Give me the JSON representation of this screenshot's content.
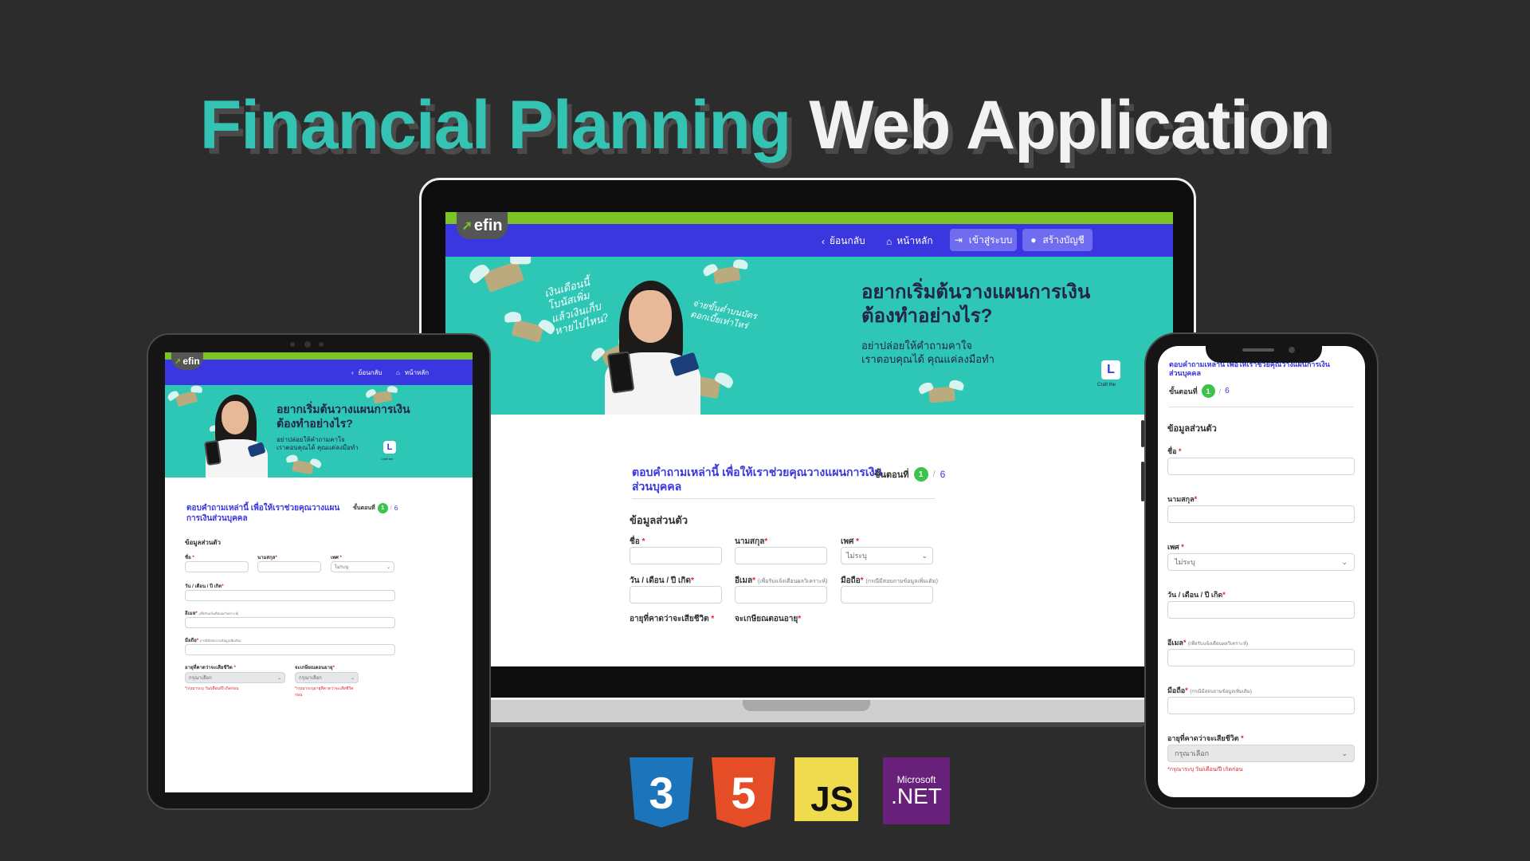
{
  "title": {
    "accent": "Financial Planning",
    "main": "Web Application"
  },
  "site": {
    "logo": "efin",
    "nav": {
      "back": "ย้อนกลับ",
      "home": "หน้าหลัก",
      "login": "เข้าสู่ระบบ",
      "register": "สร้างบัญชี"
    },
    "hero": {
      "headline_1": "อยากเริ่มต้นวางแผนการเงิน",
      "headline_2": "ต้องทำอย่างไร?",
      "sub_1": "อย่าปล่อยให้คำถามคาใจ",
      "sub_2": "เราตอบคุณได้ คุณแค่ลงมือทำ",
      "scribble_left": "เงินเดือนนี้\nโบนัสเพิ่ม\nแล้วเงินเก็บ\nหายไปไหน?",
      "scribble_right": "จ่ายขั้นต่ำบนบัตร\nดอกเบี้ยเท่าไหร่",
      "badge_logo": "L",
      "badge_caption": "Craft the"
    },
    "form": {
      "heading_1": "ตอบคำถามเหล่านี้ เพื่อให้เราช่วยคุณวางแผนการเงิน",
      "heading_2": "ส่วนบุคคล",
      "heading_tablet_1": "ตอบคำถามเหล่านี้ เพื่อให้เราช่วยคุณวางแผน",
      "heading_tablet_2": "การเงินส่วนบุคคล",
      "step_label": "ขั้นตอนที่",
      "step_current": "1",
      "step_sep": "/",
      "step_total": "6",
      "section": "ข้อมูลส่วนตัว",
      "first_name": "ชื่อ",
      "last_name": "นามสกุล",
      "gender": "เพศ",
      "gender_value": "ไม่ระบุ",
      "birthdate": "วัน / เดือน / ปี เกิด",
      "email": "อีเมล",
      "email_hint": "(เพื่อรับแจ้งเตือนผลวิเคราะห์)",
      "mobile": "มือถือ",
      "mobile_hint": "(กรณีมีสอบถามข้อมูลเพิ่มเติม)",
      "life_expectancy": "อายุที่คาดว่าจะเสียชีวิต",
      "retire_age": "จะเกษียณตอนอายุ",
      "select_placeholder": "กรุณาเลือก",
      "error_birthdate": "*กรุณาระบุ วัน/เดือน/ปี เกิดก่อน",
      "error_life": "*กรุณาระบุอายุที่คาดว่าจะเสียชีวิต",
      "error_life_tail": "ก่อน",
      "required_mark": "*"
    }
  },
  "tech_stack": [
    {
      "name": "css3-logo",
      "label": "3",
      "color": "#1c74bb"
    },
    {
      "name": "html5-logo",
      "label": "5",
      "color": "#e44d26"
    },
    {
      "name": "js-logo",
      "label": "JS",
      "color": "#f0db4f"
    },
    {
      "name": "dotnet-logo",
      "label_top": "Microsoft",
      "label": ".NET",
      "color": "#68217a"
    }
  ],
  "colors": {
    "accent_teal": "#34c3b2",
    "nav_blue": "#3a36e0",
    "hero_teal": "#2ec7b6",
    "top_green": "#7cc324",
    "background": "#2c2c2c"
  }
}
